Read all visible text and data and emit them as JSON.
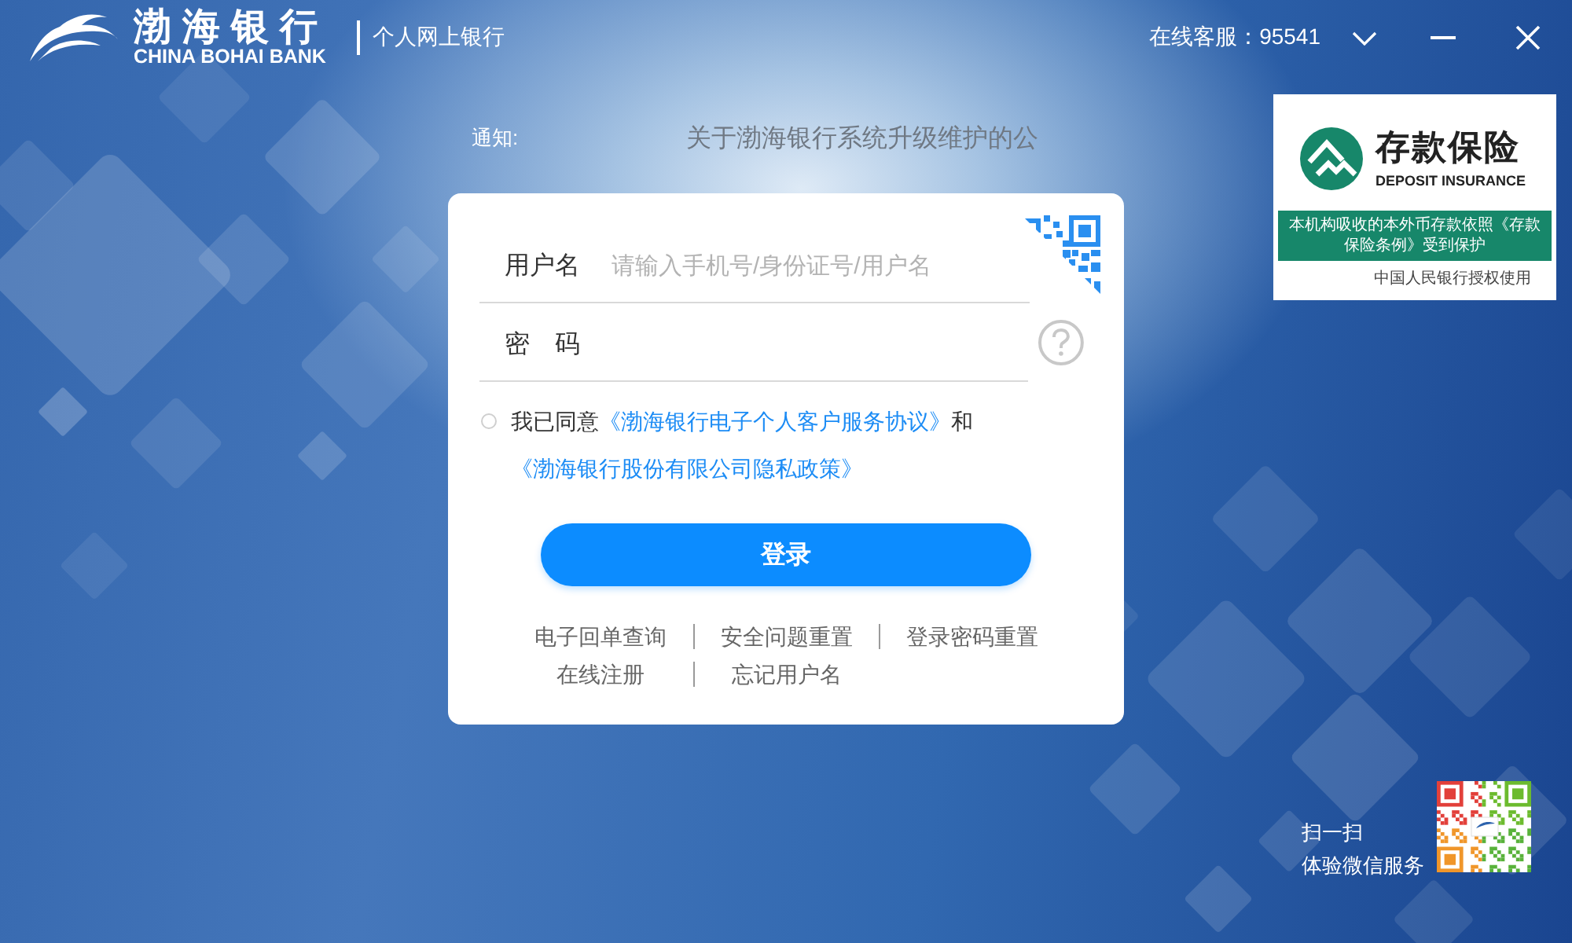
{
  "header": {
    "bank_name": "渤海银行",
    "bank_name_en": "CHINA BOHAI BANK",
    "product": "个人网上银行",
    "hotline": "在线客服：95541"
  },
  "notice": {
    "label": "通知:",
    "text": "关于渤海银行系统升级维护的公"
  },
  "login": {
    "fields": [
      {
        "kind": "text",
        "label": "用户名",
        "placeholder": "请输入手机号/身份证号/用户名"
      },
      {
        "kind": "password",
        "label": "密　码"
      }
    ],
    "agreement": {
      "checked": false,
      "parts": [
        {
          "kind": "text",
          "text": "我已同意"
        },
        {
          "kind": "link",
          "text": "《渤海银行电子个人客户服务协议》"
        },
        {
          "kind": "text",
          "text": "和"
        },
        {
          "kind": "link",
          "text": "《渤海银行股份有限公司隐私政策》"
        }
      ]
    },
    "submit": "登录",
    "link_rows": [
      [
        "电子回单查询",
        "安全问题重置",
        "登录密码重置"
      ],
      [
        "在线注册",
        "忘记用户名"
      ]
    ]
  },
  "deposit_insurance": {
    "title": "存款保险",
    "subtitle": "DEPOSIT INSURANCE",
    "statement": "本机构吸收的本外币存款依照《存款保险条例》受到保护",
    "authorization": "中国人民银行授权使用"
  },
  "wechat": {
    "lines": [
      "扫一扫",
      "体验微信服务"
    ]
  }
}
